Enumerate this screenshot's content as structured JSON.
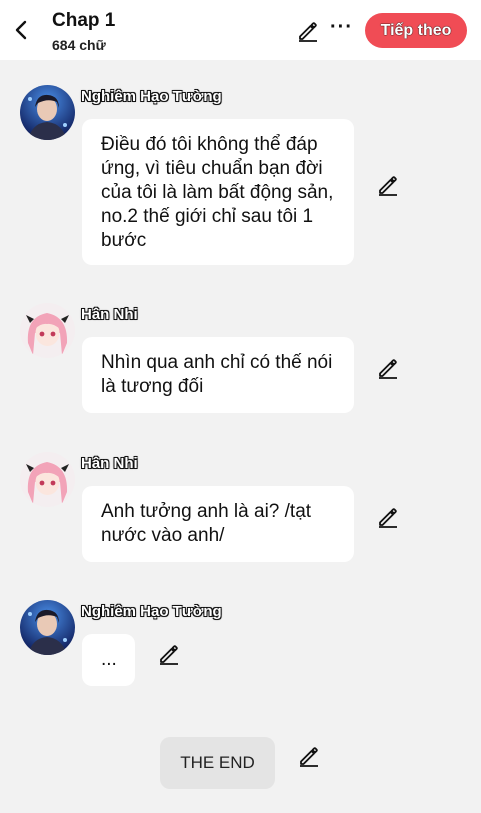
{
  "header": {
    "title": "Chap 1",
    "subtitle": "684 chữ",
    "more_label": "···",
    "next_label": "Tiếp theo"
  },
  "messages": [
    {
      "name": "Nghiêm Hạo Tường",
      "text": "Điều đó tôi không thể đáp ứng, vì tiêu chuẩn bạn đời của tôi là làm bất động sản, no.2 thế giới chỉ sau tôi 1 bước",
      "avatar": "boy-avatar"
    },
    {
      "name": "Hân Nhi",
      "text": "Nhìn qua anh chỉ có thế nói là tương đối",
      "avatar": "girl-avatar"
    },
    {
      "name": "Hân Nhi",
      "text": "Anh tưởng anh là ai? /tạt nước vào anh/",
      "avatar": "girl-avatar"
    },
    {
      "name": "Nghiêm Hạo Tường",
      "text": "...",
      "avatar": "boy-avatar"
    }
  ],
  "end_label": "THE END",
  "icons": {
    "back": "chevron-left-icon",
    "edit": "pencil-icon",
    "more": "more-dots-icon"
  },
  "colors": {
    "accent": "#f04c55",
    "background": "#f2f2f2",
    "bubble": "#ffffff",
    "end_bubble": "#e4e4e4"
  }
}
